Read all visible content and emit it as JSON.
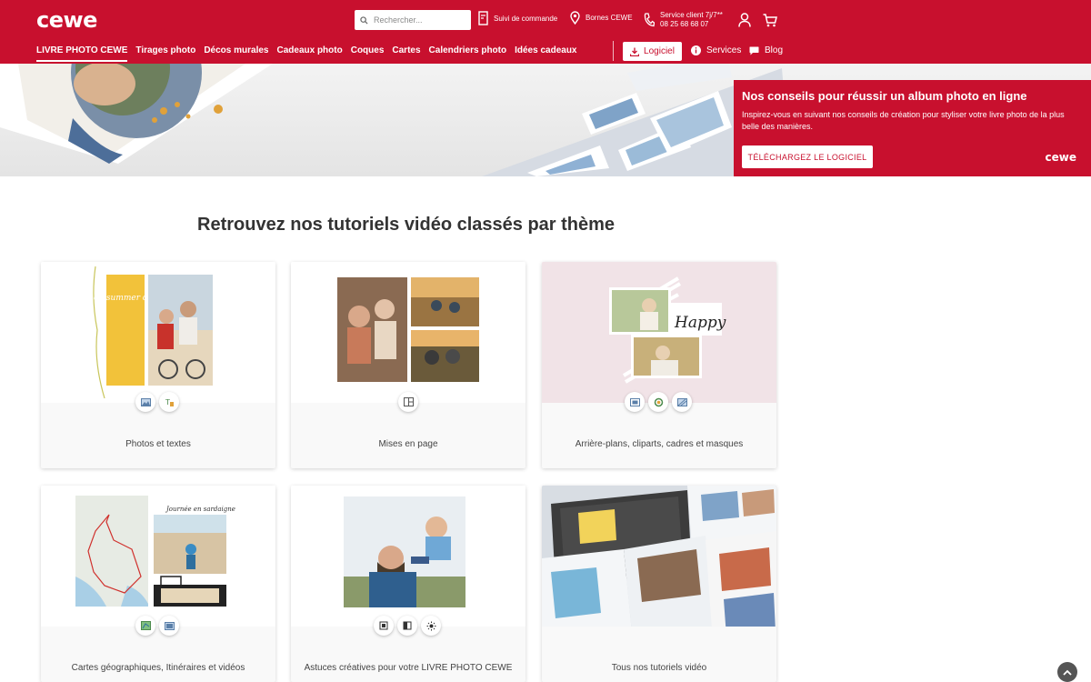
{
  "header": {
    "logo": "cewe",
    "search": {
      "placeholder": "Rechercher..."
    },
    "links": {
      "order_tracking": "Suivi de commande",
      "kiosks": "Bornes CEWE",
      "service_title": "Service client 7j/7**",
      "service_phone": "08 25 68 68 07"
    },
    "nav": [
      "LIVRE PHOTO CEWE",
      "Tirages photo",
      "Décos murales",
      "Cadeaux photo",
      "Coques",
      "Cartes",
      "Calendriers photo",
      "Idées cadeaux"
    ],
    "software_button": "Logiciel",
    "services": "Services",
    "blog": "Blog"
  },
  "promo": {
    "title": "Nos conseils pour réussir un album photo en ligne",
    "text": "Inspirez-vous en suivant nos conseils de création pour styliser votre livre photo de la plus belle des manières.",
    "cta": "TÉLÉCHARGEZ LE LOGICIEL",
    "brand": "cewe"
  },
  "section_title": "Retrouvez nos tutoriels vidéo classés par thème",
  "cards": [
    {
      "label": "Photos et textes"
    },
    {
      "label": "Mises en page"
    },
    {
      "label": "Arrière-plans, cliparts, cadres et masques"
    },
    {
      "label": "Cartes géographiques, Itinéraires et vidéos"
    },
    {
      "label": "Astuces créatives pour votre LIVRE PHOTO CEWE"
    },
    {
      "label": "Tous nos tutoriels vidéo"
    }
  ],
  "card_art": {
    "script_1": "oh summer day",
    "script_2": "Happy",
    "script_3": "Journée en sardaigne"
  },
  "colors": {
    "brand_red": "#c8102e",
    "accent_yellow": "#f2c23a"
  },
  "icons": {
    "search": "search-icon",
    "order": "document-icon",
    "kiosk": "location-pin-icon",
    "phone": "phone-icon",
    "account": "user-icon",
    "cart": "cart-icon",
    "download": "download-icon",
    "info": "info-icon",
    "chat": "chat-bubble-icon",
    "scroll_top": "chevron-up-icon"
  }
}
